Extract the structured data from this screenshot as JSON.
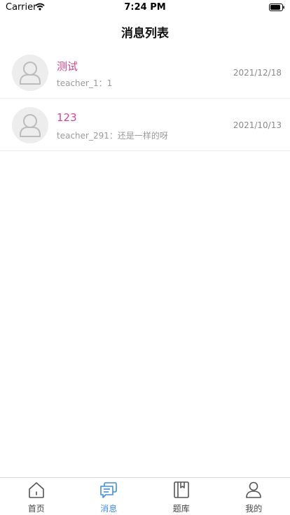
{
  "status_bar": {
    "carrier": "Carrier",
    "time": "7:24 PM"
  },
  "nav": {
    "title": "消息列表"
  },
  "messages": [
    {
      "title": "测试",
      "preview": "teacher_1：1",
      "date": "2021/12/18"
    },
    {
      "title": "123",
      "preview": "teacher_291：还是一样的呀",
      "date": "2021/10/13"
    }
  ],
  "tabs": [
    {
      "label": "首页",
      "icon": "home-icon",
      "active": false
    },
    {
      "label": "消息",
      "icon": "message-icon",
      "active": true
    },
    {
      "label": "题库",
      "icon": "book-icon",
      "active": false
    },
    {
      "label": "我的",
      "icon": "profile-icon",
      "active": false
    }
  ],
  "colors": {
    "accent": "#3d8fe8",
    "title_pink": "#d6458f",
    "muted": "#9a9a9a"
  }
}
